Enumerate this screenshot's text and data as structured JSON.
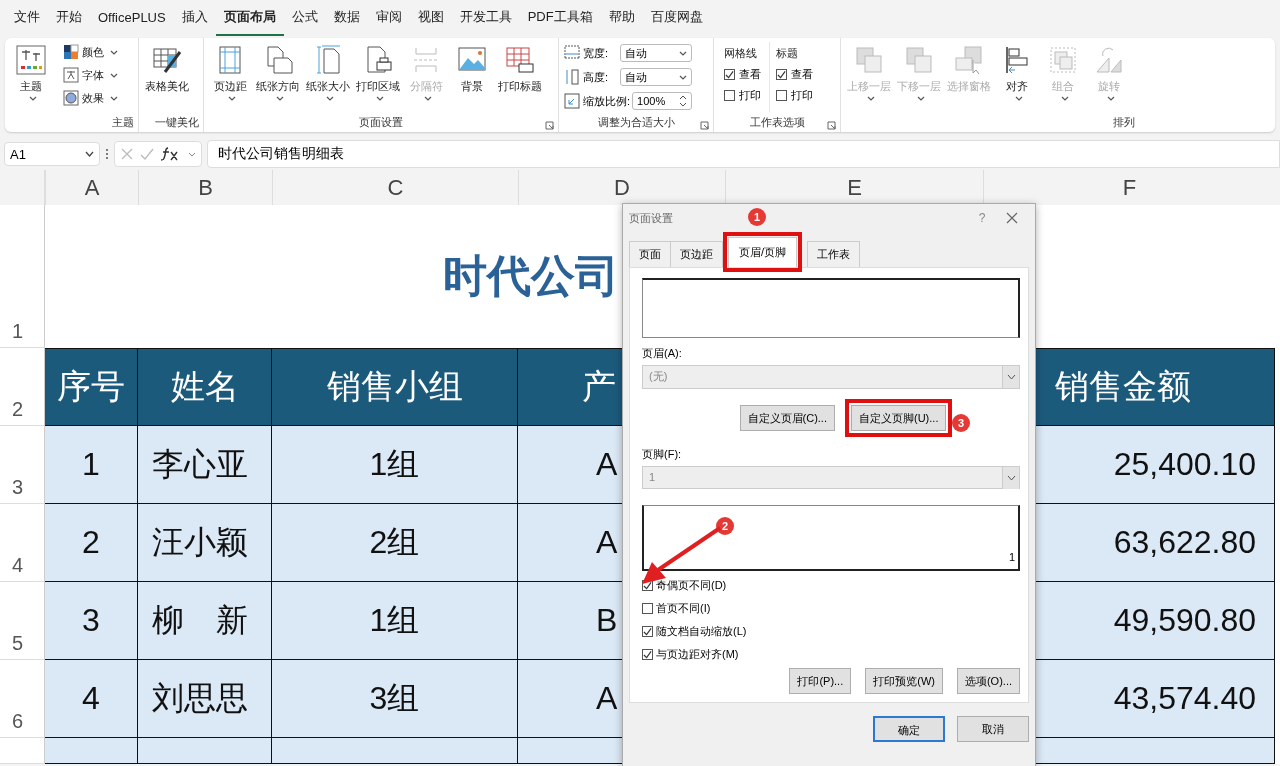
{
  "menu_tabs": [
    {
      "label": "文件",
      "selected": false
    },
    {
      "label": "开始",
      "selected": false
    },
    {
      "label": "OfficePLUS",
      "selected": false
    },
    {
      "label": "插入",
      "selected": false
    },
    {
      "label": "页面布局",
      "selected": true
    },
    {
      "label": "公式",
      "selected": false
    },
    {
      "label": "数据",
      "selected": false
    },
    {
      "label": "审阅",
      "selected": false
    },
    {
      "label": "视图",
      "selected": false
    },
    {
      "label": "开发工具",
      "selected": false
    },
    {
      "label": "PDF工具箱",
      "selected": false
    },
    {
      "label": "帮助",
      "selected": false
    },
    {
      "label": "百度网盘",
      "selected": false
    }
  ],
  "ribbon": [
    {
      "label": "主题",
      "launcher": false,
      "items": [
        {
          "kind": "big",
          "label": "主题",
          "dropdown": true,
          "disabled": false
        },
        {
          "kind": "small",
          "label": "颜色",
          "dropdown": true
        },
        {
          "kind": "small",
          "label": "字体",
          "dropdown": true
        },
        {
          "kind": "small",
          "label": "效果",
          "dropdown": true
        }
      ]
    },
    {
      "label": "一键美化",
      "launcher": false,
      "items": [
        {
          "kind": "big",
          "label": "表格美化",
          "dropdown": false,
          "disabled": false
        }
      ]
    },
    {
      "label": "页面设置",
      "launcher": true,
      "items": [
        {
          "kind": "big",
          "label": "页边距",
          "dropdown": true,
          "disabled": false
        },
        {
          "kind": "big",
          "label": "纸张方向",
          "dropdown": true,
          "disabled": false
        },
        {
          "kind": "big",
          "label": "纸张大小",
          "dropdown": true,
          "disabled": false
        },
        {
          "kind": "big",
          "label": "打印区域",
          "dropdown": true,
          "disabled": false
        },
        {
          "kind": "big",
          "label": "分隔符",
          "dropdown": true,
          "disabled": true
        },
        {
          "kind": "big",
          "label": "背景",
          "dropdown": false,
          "disabled": false
        },
        {
          "kind": "big",
          "label": "打印标题",
          "dropdown": false,
          "disabled": false
        }
      ]
    },
    {
      "label": "调整为合适大小",
      "launcher": true,
      "items": [
        {
          "kind": "field",
          "label": "宽度:",
          "value": "自动"
        },
        {
          "kind": "field",
          "label": "高度:",
          "value": "自动"
        },
        {
          "kind": "spin",
          "label": "缩放比例:",
          "value": "100%"
        }
      ]
    },
    {
      "label": "工作表选项",
      "launcher": true,
      "items": [
        {
          "kind": "checks",
          "heading": "网格线",
          "options": [
            {
              "label": "查看",
              "checked": true
            },
            {
              "label": "打印",
              "checked": false
            }
          ]
        },
        {
          "kind": "checks",
          "heading": "标题",
          "options": [
            {
              "label": "查看",
              "checked": true
            },
            {
              "label": "打印",
              "checked": false
            }
          ]
        }
      ]
    },
    {
      "label": "排列",
      "launcher": false,
      "items": [
        {
          "kind": "big",
          "label": "上移一层",
          "dropdown": true,
          "disabled": true
        },
        {
          "kind": "big",
          "label": "下移一层",
          "dropdown": true,
          "disabled": true
        },
        {
          "kind": "big",
          "label": "选择窗格",
          "dropdown": false,
          "disabled": true
        },
        {
          "kind": "big",
          "label": "对齐",
          "dropdown": true,
          "disabled": false
        },
        {
          "kind": "big",
          "label": "组合",
          "dropdown": true,
          "disabled": true
        },
        {
          "kind": "big",
          "label": "旋转",
          "dropdown": true,
          "disabled": true
        }
      ]
    }
  ],
  "formula_bar": {
    "name_box": "A1",
    "content": "时代公司销售明细表"
  },
  "sheet": {
    "columns": [
      "A",
      "B",
      "C",
      "D",
      "E",
      "F"
    ],
    "title_row": {
      "number": "1",
      "text": "时代公司"
    },
    "header_row": {
      "number": "2",
      "cells": [
        "序号",
        "姓名",
        "销售小组",
        "产",
        null,
        "销售金额"
      ]
    },
    "rows": [
      {
        "number": "3",
        "cells": [
          "1",
          "李心亚",
          "1组",
          "A",
          null,
          "25,400.10"
        ]
      },
      {
        "number": "4",
        "cells": [
          "2",
          "汪小颖",
          "2组",
          "A",
          null,
          "63,622.80"
        ]
      },
      {
        "number": "5",
        "cells": [
          "3",
          "柳　新",
          "1组",
          "B",
          null,
          "49,590.80"
        ]
      },
      {
        "number": "6",
        "cells": [
          "4",
          "刘思思",
          "3组",
          "A",
          null,
          "43,574.40"
        ]
      }
    ]
  },
  "dialog": {
    "title": "页面设置",
    "help": "?",
    "tabs": [
      {
        "label": "页面",
        "selected": false
      },
      {
        "label": "页边距",
        "selected": false
      },
      {
        "label": "页眉/页脚",
        "selected": true
      },
      {
        "label": "工作表",
        "selected": false
      }
    ],
    "header_label": "页眉(A):",
    "header_value": "(无)",
    "custom_buttons": [
      "自定义页眉(C)...",
      "自定义页脚(U)..."
    ],
    "footer_label": "页脚(F):",
    "footer_value": "1",
    "footer_preview": "1",
    "options": [
      {
        "label": "奇偶页不同(D)",
        "checked": true
      },
      {
        "label": "首页不同(I)",
        "checked": false
      },
      {
        "label": "随文档自动缩放(L)",
        "checked": true
      },
      {
        "label": "与页边距对齐(M)",
        "checked": true
      }
    ],
    "action_buttons": [
      "打印(P)...",
      "打印预览(W)",
      "选项(O)..."
    ],
    "footer_buttons": [
      {
        "label": "确定",
        "default": true
      },
      {
        "label": "取消",
        "default": false
      }
    ]
  },
  "annotations": [
    {
      "kind": "frame"
    },
    {
      "kind": "frame"
    },
    {
      "kind": "badge",
      "text": "1"
    },
    {
      "kind": "badge",
      "text": "2"
    },
    {
      "kind": "badge",
      "text": "3"
    },
    {
      "kind": "arrow"
    }
  ]
}
